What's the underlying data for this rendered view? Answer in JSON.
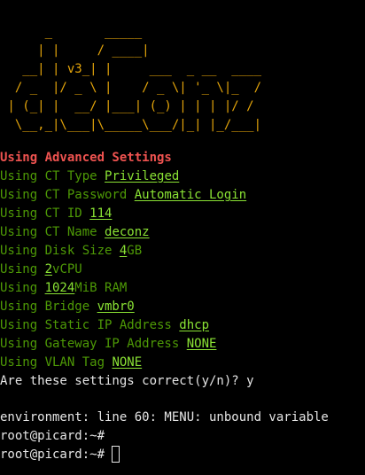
{
  "banner": [
    "      _       _____",
    "     | |     / ____|",
    "   __| | v3_| |     ___  _ __  ____",
    "  / _  |/ _ \\ |    / _ \\| '_ \\|_  /",
    " | (_| |  __/ |___| (_) | | | |/ /",
    "  \\__,_|\\___|\\_____\\___/|_| |_/___|"
  ],
  "heading": "Using Advanced Settings",
  "settings": [
    {
      "label": "Using CT Type ",
      "value": "Privileged",
      "suffix": ""
    },
    {
      "label": "Using CT Password ",
      "value": "Automatic Login",
      "suffix": ""
    },
    {
      "label": "Using CT ID ",
      "value": "114",
      "suffix": ""
    },
    {
      "label": "Using CT Name ",
      "value": "deconz",
      "suffix": ""
    },
    {
      "label": "Using Disk Size ",
      "value": "4",
      "suffix": "GB"
    },
    {
      "label": "Using ",
      "value": "2",
      "suffix": "vCPU"
    },
    {
      "label": "Using ",
      "value": "1024",
      "suffix": "MiB RAM"
    },
    {
      "label": "Using Bridge ",
      "value": "vmbr0",
      "suffix": ""
    },
    {
      "label": "Using Static IP Address ",
      "value": "dhcp",
      "suffix": ""
    },
    {
      "label": "Using Gateway IP Address ",
      "value": "NONE",
      "suffix": ""
    },
    {
      "label": "Using VLAN Tag ",
      "value": "NONE",
      "suffix": ""
    }
  ],
  "confirm_prompt": "Are these settings correct(y/n)? y",
  "error_line": "environment: line 60: MENU: unbound variable",
  "prompt_lines": [
    "root@picard:~# ",
    "root@picard:~# "
  ],
  "colors": {
    "background": "#000000",
    "banner": "#e5a50a",
    "heading": "#ef5350",
    "label": "#4e9a06",
    "value": "#8ae234",
    "text": "#e5e5e5"
  }
}
